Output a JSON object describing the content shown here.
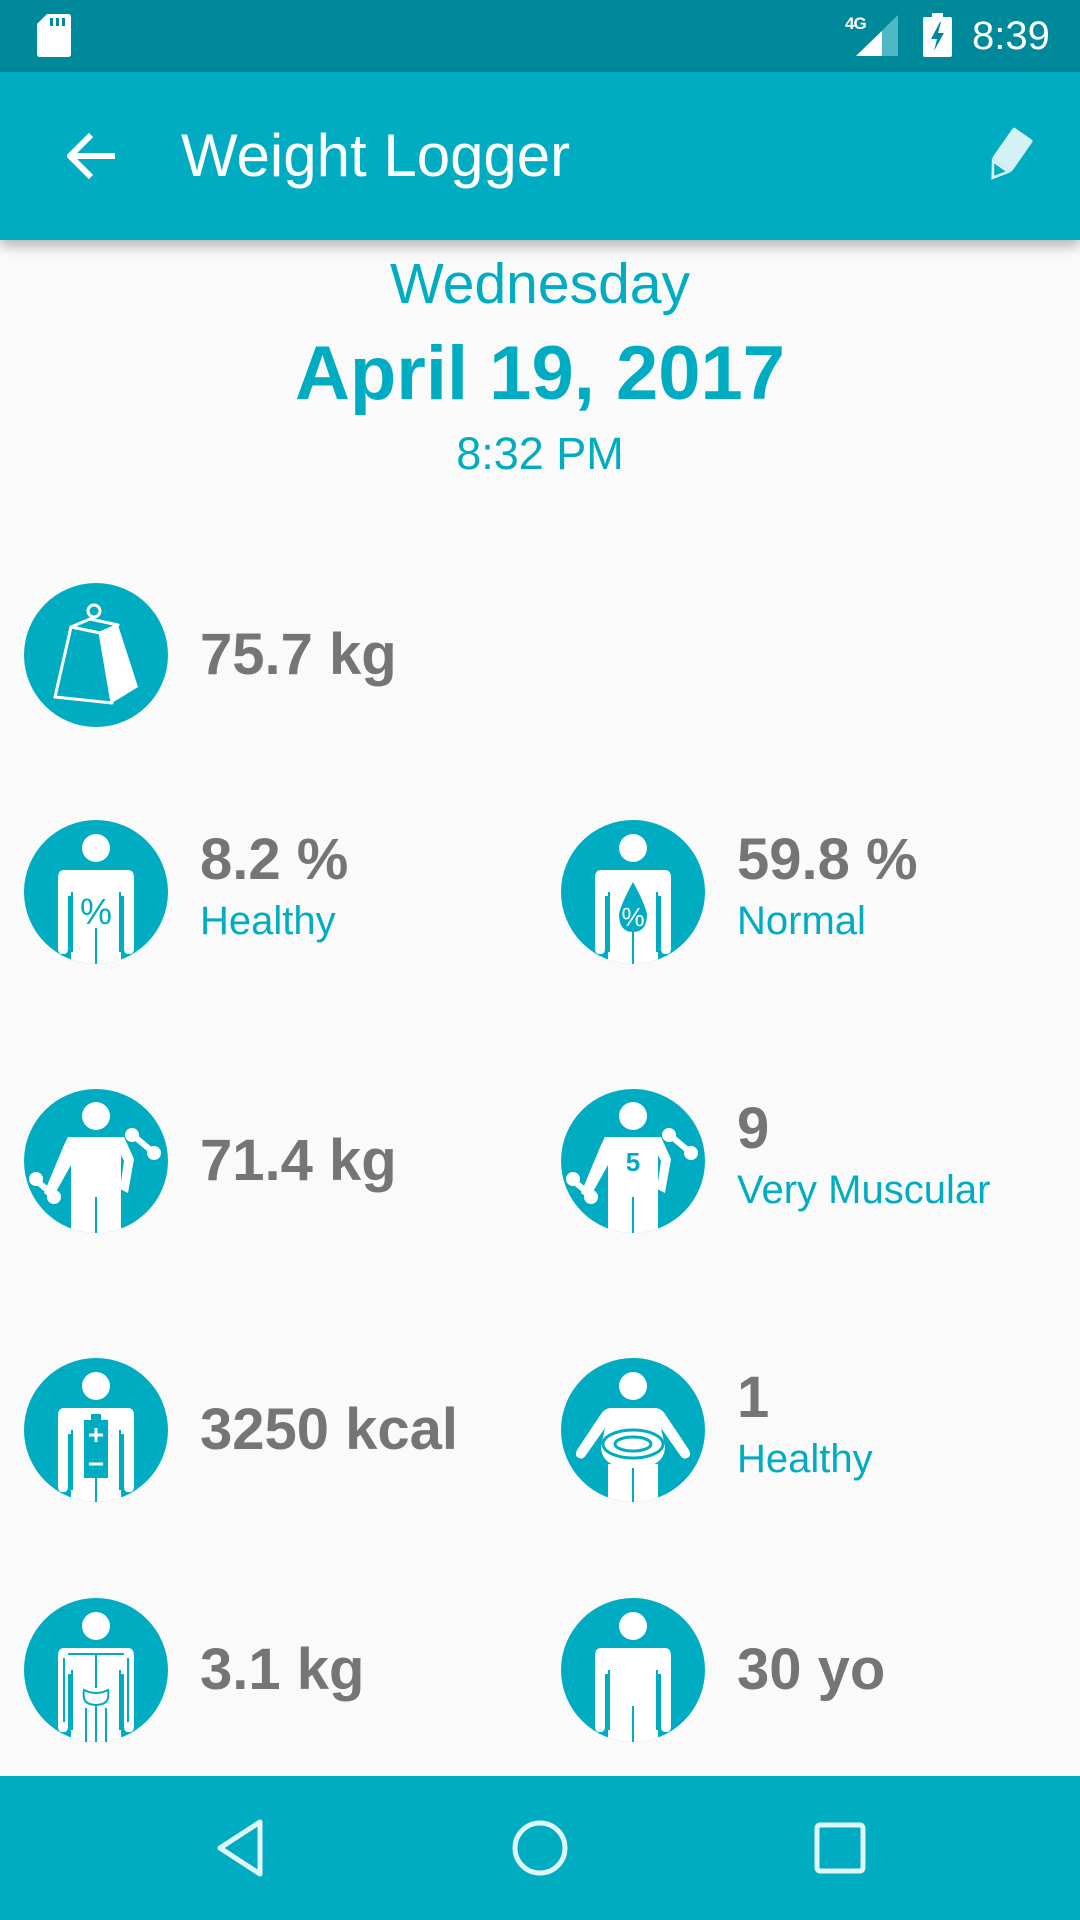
{
  "status_bar": {
    "time": "8:39",
    "network": "4G",
    "icons": [
      "sd-card-icon",
      "signal-icon",
      "battery-charging-icon"
    ]
  },
  "app_bar": {
    "title": "Weight Logger",
    "back_icon": "arrow-left-icon",
    "edit_icon": "pencil-icon"
  },
  "entry": {
    "weekday": "Wednesday",
    "date": "April 19, 2017",
    "time": "8:32 PM"
  },
  "metrics": {
    "weight": {
      "icon": "weight-icon",
      "value": "75.7 kg"
    },
    "body_fat": {
      "icon": "body-fat-icon",
      "value": "8.2 %",
      "label": "Healthy"
    },
    "body_water": {
      "icon": "body-water-icon",
      "value": "59.8 %",
      "label": "Normal"
    },
    "muscle_mass": {
      "icon": "muscle-mass-icon",
      "value": "71.4 kg"
    },
    "physique_rating": {
      "icon": "physique-rating-icon",
      "value": "9",
      "label": "Very Muscular"
    },
    "daily_calories": {
      "icon": "calories-icon",
      "value": "3250 kcal"
    },
    "visceral_fat": {
      "icon": "visceral-fat-icon",
      "value": "1",
      "label": "Healthy"
    },
    "bone_mass": {
      "icon": "bone-mass-icon",
      "value": "3.1 kg"
    },
    "age": {
      "icon": "age-icon",
      "value": "30 yo"
    }
  },
  "nav_bar": {
    "icons": [
      "back-triangle-icon",
      "home-circle-icon",
      "recents-square-icon"
    ]
  },
  "colors": {
    "primary": "#00ACC1",
    "primary_dark": "#00899B",
    "value_text": "#757575",
    "background": "#FAFAFA"
  }
}
